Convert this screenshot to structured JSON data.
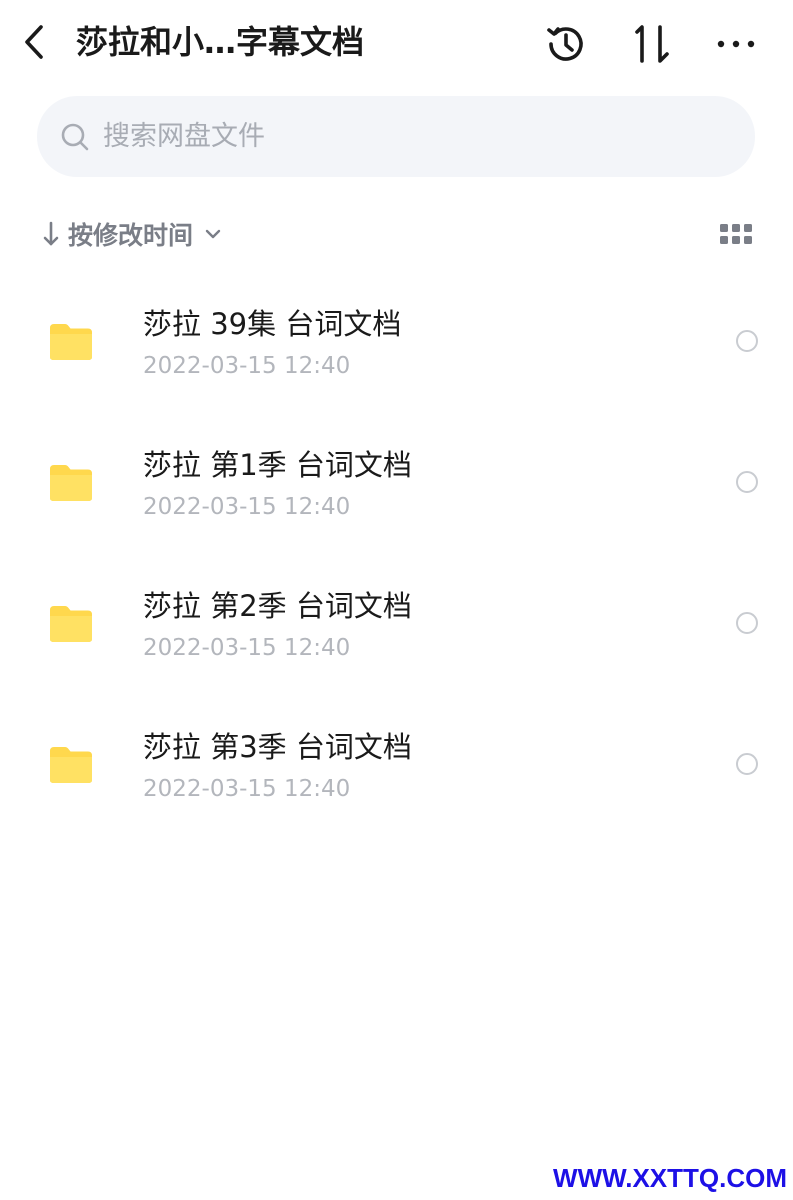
{
  "header": {
    "title": "莎拉和小…字幕文档",
    "icons": [
      "back-chevron-icon",
      "history-icon",
      "sort-transfer-icon",
      "more-icon"
    ]
  },
  "search": {
    "placeholder": "搜索网盘文件",
    "value": ""
  },
  "sort": {
    "label": "按修改时间",
    "direction_icon": "arrow-down-icon",
    "view_icon": "grid-view-icon"
  },
  "files": [
    {
      "name": "莎拉 39集 台词文档",
      "date": "2022-03-15 12:40",
      "icon": "folder-icon",
      "selected": false
    },
    {
      "name": "莎拉 第1季 台词文档",
      "date": "2022-03-15 12:40",
      "icon": "folder-icon",
      "selected": false
    },
    {
      "name": "莎拉 第2季 台词文档",
      "date": "2022-03-15 12:40",
      "icon": "folder-icon",
      "selected": false
    },
    {
      "name": "莎拉 第3季 台词文档",
      "date": "2022-03-15 12:40",
      "icon": "folder-icon",
      "selected": false
    }
  ],
  "watermark": "WWW.XXTTQ.COM",
  "colors": {
    "folder": "#ffd84d",
    "search_bg": "#f3f5f9",
    "muted_text": "#b3b6bc",
    "watermark": "#1d10e6"
  }
}
